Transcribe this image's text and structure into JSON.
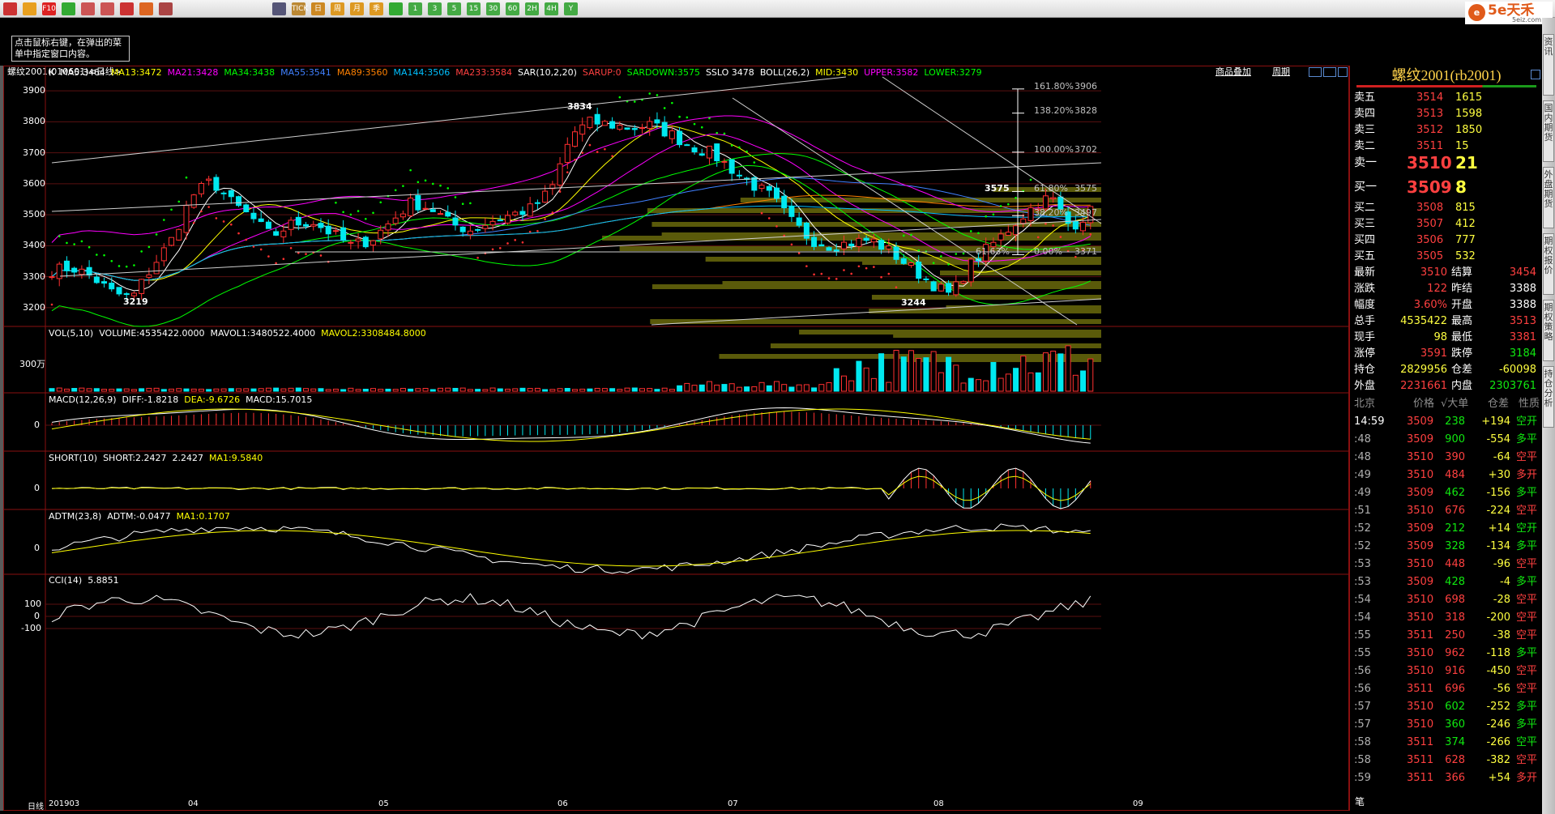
{
  "toolbar": {
    "buttons": [
      "home-icon",
      "folder-icon",
      "f10-icon",
      "refresh-icon",
      "search-icon",
      "zoom-icon",
      "pen-icon",
      "tool-icon",
      "filter-icon",
      "list-icon",
      "tick-icon",
      "day-icon",
      "week-icon",
      "month-icon",
      "quarter-icon",
      "chart-icon",
      "m1-icon",
      "m3-icon",
      "m5-icon",
      "m15-icon",
      "m30-icon",
      "m60-icon",
      "m240-icon",
      "h4-icon",
      "year-icon"
    ],
    "labels": [
      "",
      "",
      "F10",
      "",
      "",
      "",
      "",
      "",
      "",
      "",
      "TICK",
      "日",
      "周",
      "月",
      "季",
      "",
      "1",
      "3",
      "5",
      "15",
      "30",
      "60",
      "2H",
      "4H",
      "Y"
    ]
  },
  "logo": {
    "text": "5e天禾",
    "sub": "5eiz.com",
    "circ": "e"
  },
  "hint": {
    "text": "点击鼠标右键，在弹出的菜单中指定窗口内容。"
  },
  "title": {
    "text": "螺纹2001(010601)<日线>",
    "link1": "商品叠加",
    "link2": "周期"
  },
  "main": {
    "ind": [
      {
        "t": "K",
        "c": "#ffffff"
      },
      {
        "t": "MA5:3464",
        "c": "#ffffff"
      },
      {
        "t": "MA13:3472",
        "c": "#ffff00"
      },
      {
        "t": "MA21:3428",
        "c": "#ff00ff"
      },
      {
        "t": "MA34:3438",
        "c": "#00ff00"
      },
      {
        "t": "MA55:3541",
        "c": "#4080ff"
      },
      {
        "t": "MA89:3560",
        "c": "#ff8000"
      },
      {
        "t": "MA144:3506",
        "c": "#00c0ff"
      },
      {
        "t": "MA233:3584",
        "c": "#ff4040"
      },
      {
        "t": "SAR(10,2,20)",
        "c": "#ffffff"
      },
      {
        "t": "SARUP:0",
        "c": "#ff4040"
      },
      {
        "t": "SARDOWN:3575",
        "c": "#00ff00"
      },
      {
        "t": "SSLO 3478",
        "c": "#ffffff"
      },
      {
        "t": "BOLL(26,2)",
        "c": "#ffffff"
      },
      {
        "t": "MID:3430",
        "c": "#ffff00"
      },
      {
        "t": "UPPER:3582",
        "c": "#ff00ff"
      },
      {
        "t": "LOWER:3279",
        "c": "#00ff00"
      }
    ],
    "yticks": [
      "3900",
      "3800",
      "3700",
      "3600",
      "3500",
      "3400",
      "3300",
      "3200"
    ],
    "fib": [
      {
        "p": "161.80%",
        "v": "3906"
      },
      {
        "p": "138.20%",
        "v": "3828"
      },
      {
        "p": "100.00%",
        "v": "3702"
      },
      {
        "p": "61.80%",
        "v": "3575"
      },
      {
        "p": "38.20%",
        "v": "3497"
      },
      {
        "p": "0.00%",
        "v": "3371"
      }
    ],
    "fibneg": "-61.63%",
    "marks": {
      "high": "3834",
      "low": "3219",
      "low2": "3244",
      "mid": "3575"
    }
  },
  "vol": {
    "ind": [
      {
        "t": "VOL(5,10)",
        "c": "#ffffff"
      },
      {
        "t": "VOLUME:4535422.0000",
        "c": "#ffffff"
      },
      {
        "t": "MAVOL1:3480522.4000",
        "c": "#ffffff"
      },
      {
        "t": "MAVOL2:3308484.8000",
        "c": "#ffff00"
      }
    ],
    "tick": "300万"
  },
  "macd": {
    "ind": [
      {
        "t": "MACD(12,26,9)",
        "c": "#ffffff"
      },
      {
        "t": "DIFF:-1.8218",
        "c": "#ffffff"
      },
      {
        "t": "DEA:-9.6726",
        "c": "#ffff00"
      },
      {
        "t": "MACD:15.7015",
        "c": "#ffffff"
      }
    ],
    "tick": "0"
  },
  "short": {
    "ind": [
      {
        "t": "SHORT(10)",
        "c": "#ffffff"
      },
      {
        "t": "SHORT:2.2427",
        "c": "#ffffff"
      },
      {
        "t": "2.2427",
        "c": "#ffffff"
      },
      {
        "t": "MA1:9.5840",
        "c": "#ffff00"
      }
    ],
    "tick": "0"
  },
  "adtm": {
    "ind": [
      {
        "t": "ADTM(23,8)",
        "c": "#ffffff"
      },
      {
        "t": "ADTM:-0.0477",
        "c": "#ffffff"
      },
      {
        "t": "MA1:0.1707",
        "c": "#ffff00"
      }
    ],
    "tick": "0"
  },
  "cci": {
    "ind": [
      {
        "t": "CCI(14)",
        "c": "#ffffff"
      },
      {
        "t": "5.8851",
        "c": "#ffffff"
      }
    ],
    "ticks": [
      "100",
      "0",
      "-100"
    ]
  },
  "xaxis": {
    "label": "日线",
    "start": "201903",
    "months": [
      "04",
      "05",
      "06",
      "07",
      "08",
      "09"
    ]
  },
  "quote": {
    "title": "螺纹2001(rb2001)",
    "asks": [
      {
        "l": "卖五",
        "p": "3514",
        "v": "1615"
      },
      {
        "l": "卖四",
        "p": "3513",
        "v": "1598"
      },
      {
        "l": "卖三",
        "p": "3512",
        "v": "1850"
      },
      {
        "l": "卖二",
        "p": "3511",
        "v": "15"
      },
      {
        "l": "卖一",
        "p": "3510",
        "v": "21"
      }
    ],
    "bids": [
      {
        "l": "买一",
        "p": "3509",
        "v": "8"
      },
      {
        "l": "买二",
        "p": "3508",
        "v": "815"
      },
      {
        "l": "买三",
        "p": "3507",
        "v": "412"
      },
      {
        "l": "买四",
        "p": "3506",
        "v": "777"
      },
      {
        "l": "买五",
        "p": "3505",
        "v": "532"
      }
    ],
    "stats": [
      {
        "l1": "最新",
        "v1": "3510",
        "c1": "red",
        "l2": "结算",
        "v2": "3454",
        "c2": "red"
      },
      {
        "l1": "涨跌",
        "v1": "122",
        "c1": "red",
        "l2": "昨结",
        "v2": "3388",
        "c2": "wht"
      },
      {
        "l1": "幅度",
        "v1": "3.60%",
        "c1": "red",
        "l2": "开盘",
        "v2": "3388",
        "c2": "wht"
      },
      {
        "l1": "总手",
        "v1": "4535422",
        "c1": "yel",
        "l2": "最高",
        "v2": "3513",
        "c2": "red"
      },
      {
        "l1": "现手",
        "v1": "98",
        "c1": "yel",
        "l2": "最低",
        "v2": "3381",
        "c2": "red"
      },
      {
        "l1": "涨停",
        "v1": "3591",
        "c1": "red",
        "l2": "跌停",
        "v2": "3184",
        "c2": "grn"
      },
      {
        "l1": "持仓",
        "v1": "2829956",
        "c1": "yel",
        "l2": "仓差",
        "v2": "-60098",
        "c2": "yel"
      },
      {
        "l1": "外盘",
        "v1": "2231661",
        "c1": "red",
        "l2": "内盘",
        "v2": "2303761",
        "c2": "grn"
      }
    ],
    "tickhdr": {
      "a": "北京",
      "b": "价格",
      "c": "√大单",
      "d": "仓差",
      "e": "性质"
    },
    "ticks": [
      {
        "t": "14:59",
        "p": "3509",
        "v": "238",
        "d": "+194",
        "n": "空开",
        "tc": "wht",
        "vc": "grn",
        "dc": "yel",
        "nc": "grn"
      },
      {
        "t": ":48",
        "p": "3509",
        "v": "900",
        "d": "-554",
        "n": "多平",
        "tc": "gry",
        "vc": "grn",
        "dc": "yel",
        "nc": "grn"
      },
      {
        "t": ":48",
        "p": "3510",
        "v": "390",
        "d": "-64",
        "n": "空平",
        "tc": "gry",
        "vc": "red",
        "dc": "yel",
        "nc": "red"
      },
      {
        "t": ":49",
        "p": "3510",
        "v": "484",
        "d": "+30",
        "n": "多开",
        "tc": "gry",
        "vc": "red",
        "dc": "yel",
        "nc": "red"
      },
      {
        "t": ":49",
        "p": "3509",
        "v": "462",
        "d": "-156",
        "n": "多平",
        "tc": "gry",
        "vc": "grn",
        "dc": "yel",
        "nc": "grn"
      },
      {
        "t": ":51",
        "p": "3510",
        "v": "676",
        "d": "-224",
        "n": "空平",
        "tc": "gry",
        "vc": "red",
        "dc": "yel",
        "nc": "red"
      },
      {
        "t": ":52",
        "p": "3509",
        "v": "212",
        "d": "+14",
        "n": "空开",
        "tc": "gry",
        "vc": "grn",
        "dc": "yel",
        "nc": "grn"
      },
      {
        "t": ":52",
        "p": "3509",
        "v": "328",
        "d": "-134",
        "n": "多平",
        "tc": "gry",
        "vc": "grn",
        "dc": "yel",
        "nc": "grn"
      },
      {
        "t": ":53",
        "p": "3510",
        "v": "448",
        "d": "-96",
        "n": "空平",
        "tc": "gry",
        "vc": "red",
        "dc": "yel",
        "nc": "red"
      },
      {
        "t": ":53",
        "p": "3509",
        "v": "428",
        "d": "-4",
        "n": "多平",
        "tc": "gry",
        "vc": "grn",
        "dc": "yel",
        "nc": "grn"
      },
      {
        "t": ":54",
        "p": "3510",
        "v": "698",
        "d": "-28",
        "n": "空平",
        "tc": "gry",
        "vc": "red",
        "dc": "yel",
        "nc": "red"
      },
      {
        "t": ":54",
        "p": "3510",
        "v": "318",
        "d": "-200",
        "n": "空平",
        "tc": "gry",
        "vc": "red",
        "dc": "yel",
        "nc": "red"
      },
      {
        "t": ":55",
        "p": "3511",
        "v": "250",
        "d": "-38",
        "n": "空平",
        "tc": "gry",
        "vc": "red",
        "dc": "yel",
        "nc": "red"
      },
      {
        "t": ":55",
        "p": "3510",
        "v": "962",
        "d": "-118",
        "n": "多平",
        "tc": "gry",
        "vc": "red",
        "dc": "yel",
        "nc": "grn"
      },
      {
        "t": ":56",
        "p": "3510",
        "v": "916",
        "d": "-450",
        "n": "空平",
        "tc": "gry",
        "vc": "red",
        "dc": "yel",
        "nc": "red"
      },
      {
        "t": ":56",
        "p": "3511",
        "v": "696",
        "d": "-56",
        "n": "空平",
        "tc": "gry",
        "vc": "red",
        "dc": "yel",
        "nc": "red"
      },
      {
        "t": ":57",
        "p": "3510",
        "v": "602",
        "d": "-252",
        "n": "多平",
        "tc": "gry",
        "vc": "grn",
        "dc": "yel",
        "nc": "grn"
      },
      {
        "t": ":57",
        "p": "3510",
        "v": "360",
        "d": "-246",
        "n": "多平",
        "tc": "gry",
        "vc": "grn",
        "dc": "yel",
        "nc": "grn"
      },
      {
        "t": ":58",
        "p": "3511",
        "v": "374",
        "d": "-266",
        "n": "空平",
        "tc": "gry",
        "vc": "grn",
        "dc": "yel",
        "nc": "grn"
      },
      {
        "t": ":58",
        "p": "3511",
        "v": "628",
        "d": "-382",
        "n": "空平",
        "tc": "gry",
        "vc": "red",
        "dc": "yel",
        "nc": "red"
      },
      {
        "t": ":59",
        "p": "3511",
        "v": "366",
        "d": "+54",
        "n": "多开",
        "tc": "gry",
        "vc": "red",
        "dc": "yel",
        "nc": "red"
      }
    ],
    "footer": "笔"
  },
  "side": {
    "tabs": [
      "资讯",
      "国内期货",
      "外盘期货",
      "期权报价",
      "期权策略",
      "持仓分析"
    ]
  }
}
